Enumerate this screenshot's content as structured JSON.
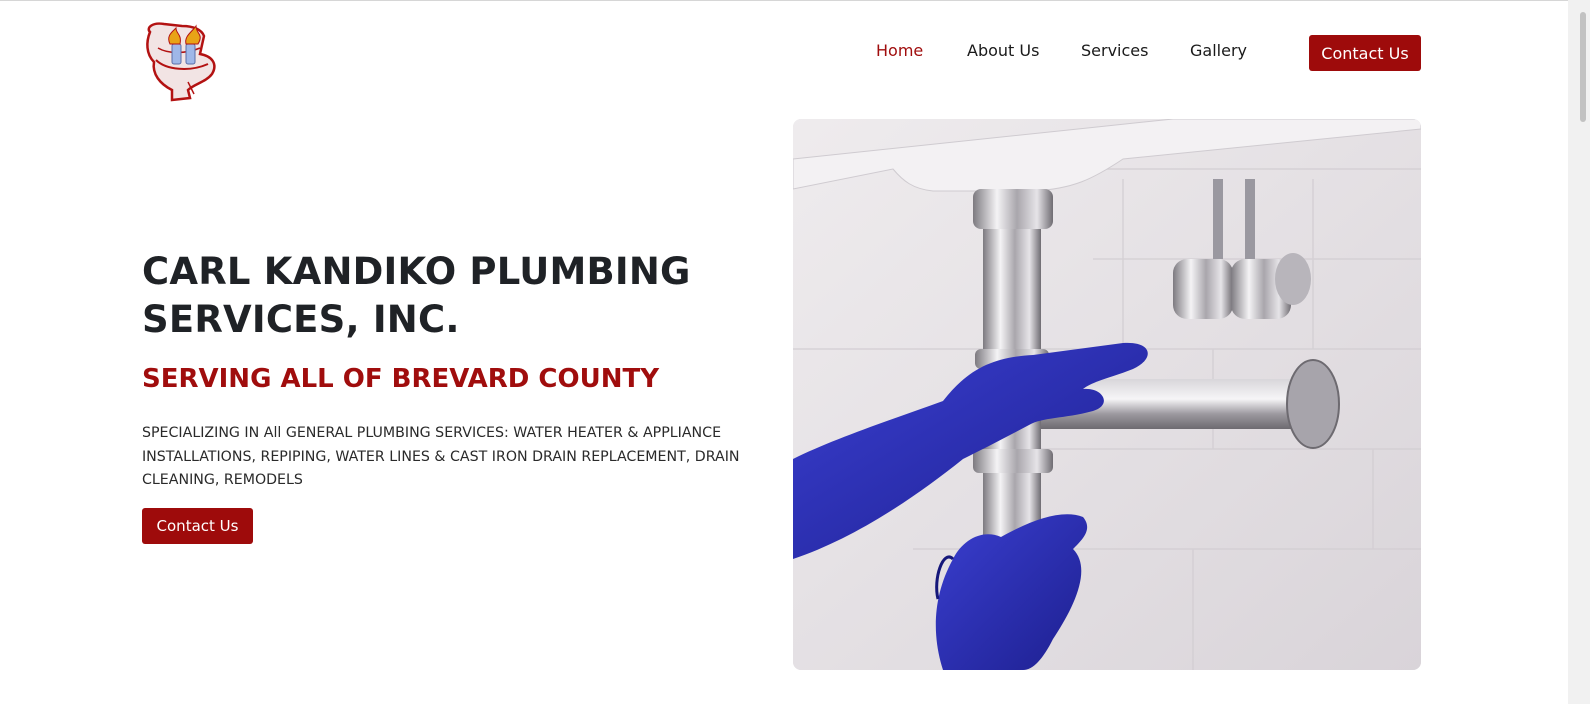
{
  "brand": {
    "logo_icon": "plumbing-logo-icon",
    "accent_color": "#9e0b0b"
  },
  "nav": {
    "items": [
      {
        "label": "Home",
        "active": true
      },
      {
        "label": "About Us",
        "active": false
      },
      {
        "label": "Services",
        "active": false
      },
      {
        "label": "Gallery",
        "active": false
      }
    ],
    "cta_label": "Contact Us"
  },
  "hero": {
    "title": "CARL KANDIKO PLUMBING SERVICES, INC.",
    "subtitle": "SERVING ALL OF BREVARD COUNTY",
    "description": "SPECIALIZING IN All GENERAL PLUMBING SERVICES: WATER HEATER & APPLIANCE INSTALLATIONS, REPIPING, WATER LINES & CAST IRON DRAIN REPLACEMENT, DRAIN CLEANING, REMODELS",
    "cta_label": "Contact Us",
    "image_icon": "plumber-fixing-sink-pipe-photo"
  }
}
